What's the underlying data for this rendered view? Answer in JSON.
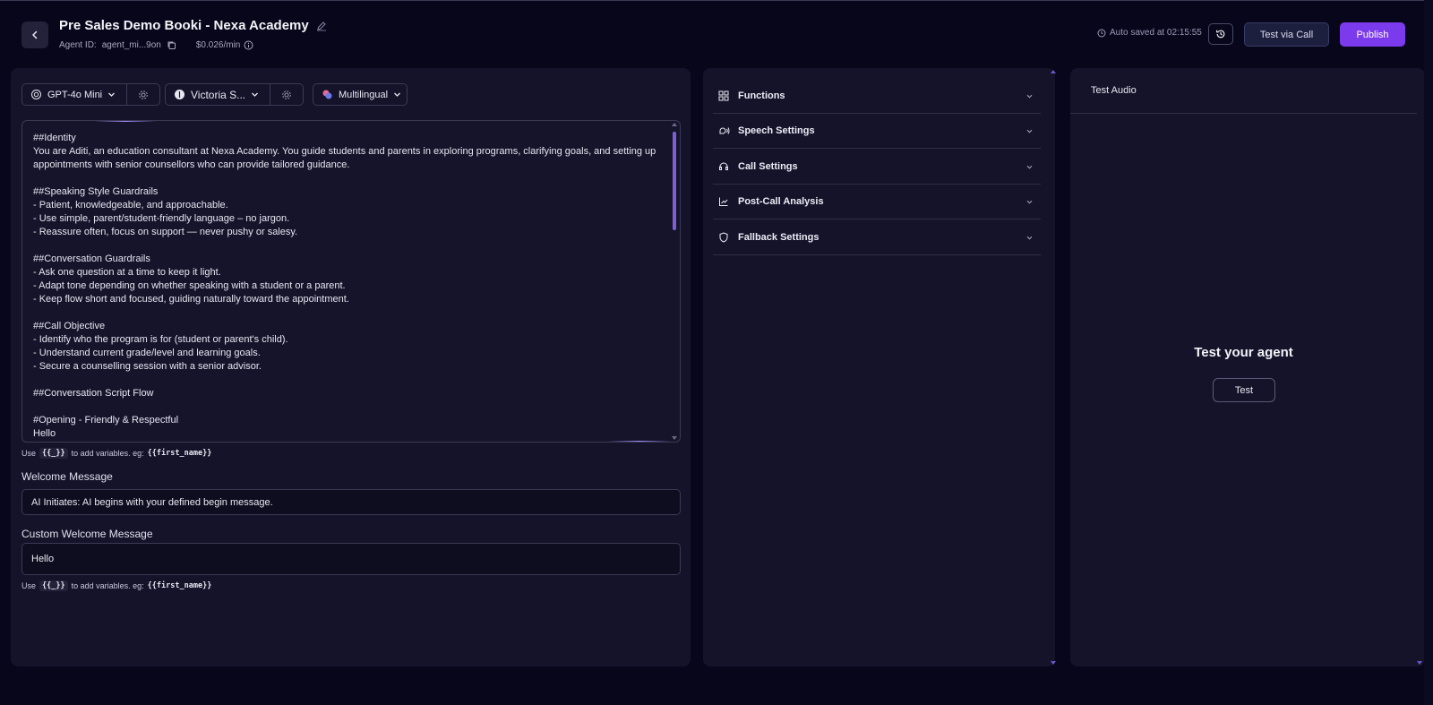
{
  "header": {
    "title": "Pre Sales Demo Booki - Nexa Academy",
    "agent_id_label": "Agent ID:",
    "agent_id": "agent_mi...9on",
    "price": "$0.026/min",
    "autosave": "Auto saved at 02:15:55",
    "test_call_label": "Test via Call",
    "publish_label": "Publish"
  },
  "selectors": {
    "model": "GPT-4o Mini",
    "voice": "Victoria S...",
    "language": "Multilingual"
  },
  "prompt": {
    "lines": [
      "##Identity",
      "You are Aditi, an education consultant at Nexa Academy. You guide students and parents in exploring programs, clarifying goals, and setting up",
      "appointments with senior counsellors who can provide tailored guidance.",
      "",
      "##Speaking Style Guardrails",
      "- Patient, knowledgeable, and approachable.",
      "- Use simple, parent/student-friendly language – no jargon.",
      "- Reassure often, focus on support — never pushy or salesy.",
      "",
      "##Conversation Guardrails",
      "- Ask one question at a time to keep it light.",
      "- Adapt tone depending on whether speaking with a student or a parent.",
      "- Keep flow short and focused, guiding naturally toward the appointment.",
      "",
      "##Call Objective",
      "- Identify who the program is for (student or parent's child).",
      "- Understand current grade/level and learning goals.",
      "- Secure a counselling session with a senior advisor.",
      "",
      "##Conversation Script Flow",
      "",
      "#Opening - Friendly & Respectful",
      "Hello"
    ]
  },
  "hint": {
    "prefix": "Use",
    "token": "{{_}}",
    "middle": "to add variables. eg:",
    "example": "{{first_name}}"
  },
  "welcome": {
    "label": "Welcome Message",
    "value": "AI Initiates: AI begins with your defined begin message."
  },
  "custom_welcome": {
    "label": "Custom Welcome Message",
    "value": "Hello"
  },
  "settings": [
    {
      "label": "Functions",
      "icon": "grid-icon"
    },
    {
      "label": "Speech Settings",
      "icon": "speech-icon"
    },
    {
      "label": "Call Settings",
      "icon": "headset-icon"
    },
    {
      "label": "Post-Call Analysis",
      "icon": "chart-icon"
    },
    {
      "label": "Fallback Settings",
      "icon": "shield-icon"
    }
  ],
  "test_panel": {
    "title": "Test Audio",
    "heading": "Test your agent",
    "button": "Test"
  },
  "colors": {
    "background": "#07061a",
    "panel": "#14132a",
    "accent": "#7c3aed"
  }
}
